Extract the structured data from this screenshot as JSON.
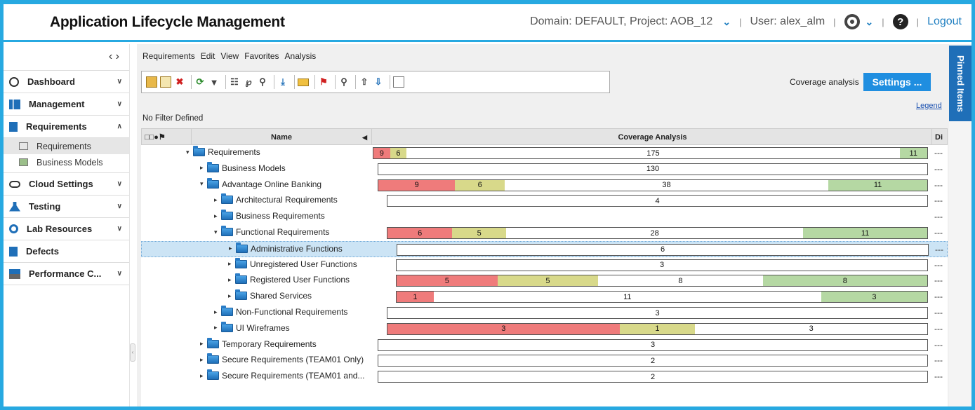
{
  "header": {
    "title": "Application Lifecycle Management",
    "domain_project": "Domain: DEFAULT, Project: AOB_12",
    "user": "User: alex_alm",
    "logout": "Logout"
  },
  "sidebar": {
    "nav_arrows": "‹ ›",
    "items": [
      {
        "label": "Dashboard",
        "icon": "dashboard-icon"
      },
      {
        "label": "Management",
        "icon": "management-icon"
      },
      {
        "label": "Requirements",
        "icon": "requirements-icon"
      },
      {
        "label": "Cloud Settings",
        "icon": "cloud-icon"
      },
      {
        "label": "Testing",
        "icon": "testing-icon"
      },
      {
        "label": "Lab Resources",
        "icon": "lab-icon"
      },
      {
        "label": "Defects",
        "icon": "defects-icon"
      },
      {
        "label": "Performance C...",
        "icon": "performance-icon"
      }
    ],
    "sub_items": [
      {
        "label": "Requirements"
      },
      {
        "label": "Business Models"
      }
    ]
  },
  "menu": [
    "Requirements",
    "Edit",
    "View",
    "Favorites",
    "Analysis"
  ],
  "toolbar": {
    "coverage_label": "Coverage analysis",
    "settings_label": "Settings ...",
    "legend": "Legend"
  },
  "filter_text": "No Filter Defined",
  "grid": {
    "col_name": "Name",
    "col_coverage": "Coverage Analysis",
    "col_di": "Di",
    "rows": [
      {
        "name": "Requirements",
        "level": 0,
        "expanded": true,
        "segments": [
          {
            "c": "red",
            "v": "9",
            "w": 3
          },
          {
            "c": "yel",
            "v": "6",
            "w": 3
          },
          {
            "c": "wht",
            "v": "175",
            "w": 89
          },
          {
            "c": "grn",
            "v": "11",
            "w": 5
          }
        ],
        "dash": "---"
      },
      {
        "name": "Business Models",
        "level": 1,
        "expanded": false,
        "segments": [
          {
            "c": "wht",
            "v": "130",
            "w": 100
          }
        ],
        "dash": "---"
      },
      {
        "name": "Advantage Online Banking",
        "level": 1,
        "expanded": true,
        "segments": [
          {
            "c": "red",
            "v": "9",
            "w": 14
          },
          {
            "c": "yel",
            "v": "6",
            "w": 9
          },
          {
            "c": "wht",
            "v": "38",
            "w": 59
          },
          {
            "c": "grn",
            "v": "11",
            "w": 18
          }
        ],
        "dash": "---"
      },
      {
        "name": "Architectural Requirements",
        "level": 2,
        "expanded": false,
        "segments": [
          {
            "c": "wht",
            "v": "4",
            "w": 100
          }
        ],
        "dash": "---"
      },
      {
        "name": "Business Requirements",
        "level": 2,
        "expanded": false,
        "segments": [],
        "dash": "---"
      },
      {
        "name": "Functional Requirements",
        "level": 2,
        "expanded": true,
        "segments": [
          {
            "c": "red",
            "v": "6",
            "w": 12
          },
          {
            "c": "yel",
            "v": "5",
            "w": 10
          },
          {
            "c": "wht",
            "v": "28",
            "w": 55
          },
          {
            "c": "grn",
            "v": "11",
            "w": 23
          }
        ],
        "dash": "---"
      },
      {
        "name": "Administrative Functions",
        "level": 3,
        "expanded": false,
        "selected": true,
        "segments": [
          {
            "c": "wht",
            "v": "6",
            "w": 100
          }
        ],
        "dash": "---"
      },
      {
        "name": "Unregistered User Functions",
        "level": 3,
        "expanded": false,
        "segments": [
          {
            "c": "wht",
            "v": "3",
            "w": 100
          }
        ],
        "dash": "---"
      },
      {
        "name": "Registered User Functions",
        "level": 3,
        "expanded": false,
        "segments": [
          {
            "c": "red",
            "v": "5",
            "w": 19
          },
          {
            "c": "yel",
            "v": "5",
            "w": 19
          },
          {
            "c": "wht",
            "v": "8",
            "w": 31
          },
          {
            "c": "grn",
            "v": "8",
            "w": 31
          }
        ],
        "dash": "---"
      },
      {
        "name": "Shared Services",
        "level": 3,
        "expanded": false,
        "segments": [
          {
            "c": "red",
            "v": "1",
            "w": 7
          },
          {
            "c": "wht",
            "v": "11",
            "w": 73
          },
          {
            "c": "grn",
            "v": "3",
            "w": 20
          }
        ],
        "dash": "---"
      },
      {
        "name": "Non-Functional Requirements",
        "level": 2,
        "expanded": false,
        "segments": [
          {
            "c": "wht",
            "v": "3",
            "w": 100
          }
        ],
        "dash": "---"
      },
      {
        "name": "UI Wireframes",
        "level": 2,
        "expanded": false,
        "segments": [
          {
            "c": "red",
            "v": "3",
            "w": 43
          },
          {
            "c": "yel",
            "v": "1",
            "w": 14
          },
          {
            "c": "wht",
            "v": "3",
            "w": 43
          }
        ],
        "dash": "---"
      },
      {
        "name": "Temporary Requirements",
        "level": 1,
        "expanded": false,
        "segments": [
          {
            "c": "wht",
            "v": "3",
            "w": 100
          }
        ],
        "dash": "---"
      },
      {
        "name": "Secure Requirements (TEAM01 Only)",
        "level": 1,
        "expanded": false,
        "segments": [
          {
            "c": "wht",
            "v": "2",
            "w": 100
          }
        ],
        "dash": "---"
      },
      {
        "name": "Secure Requirements (TEAM01 and...",
        "level": 1,
        "expanded": false,
        "segments": [
          {
            "c": "wht",
            "v": "2",
            "w": 100
          }
        ],
        "dash": "---"
      }
    ]
  },
  "pinned": "Pinned Items"
}
